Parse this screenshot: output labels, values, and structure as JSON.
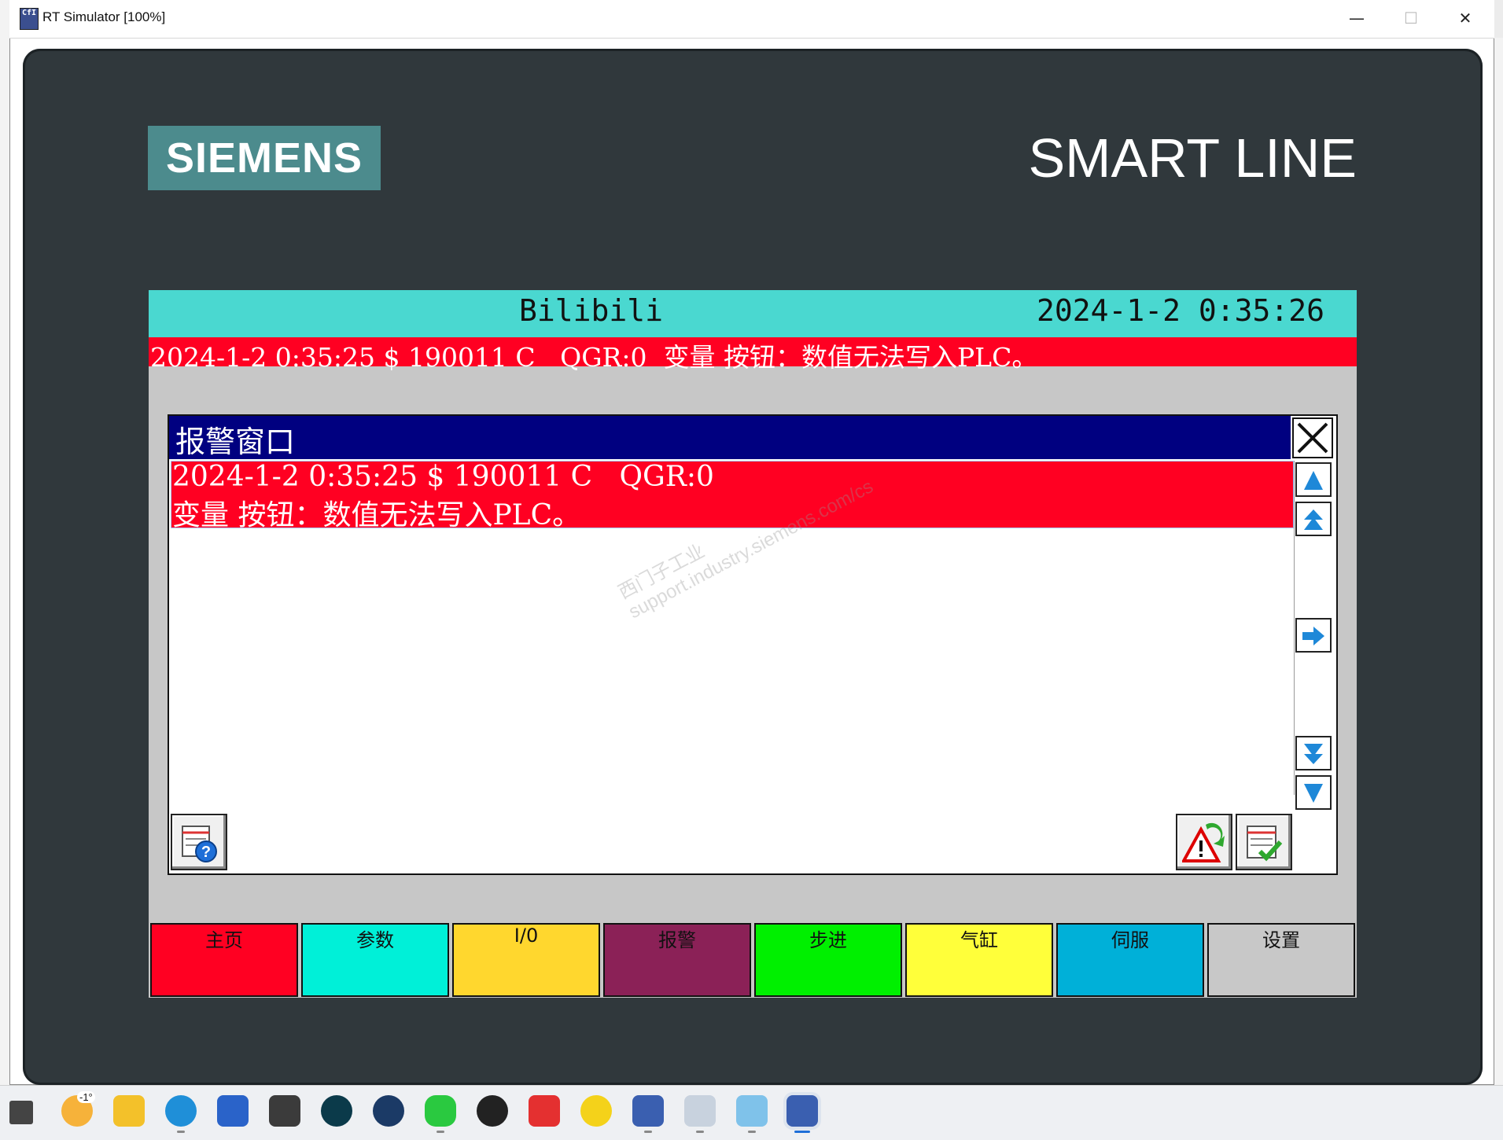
{
  "window": {
    "title": "RT Simulator [100%]",
    "icon_text": "CfI",
    "minimize_glyph": "—",
    "maximize_glyph": "☐",
    "close_glyph": "✕"
  },
  "device": {
    "brand": "SIEMENS",
    "model": "SMART LINE"
  },
  "screen": {
    "title": "Bilibili",
    "datetime": "2024-1-2 0:35:26",
    "alarm_line": "2024-1-2 0:35:25 $ 190011 C   QGR:0  变量 按钮：数值无法写入PLC。"
  },
  "alarm_window": {
    "title": "报警窗口",
    "entries": [
      {
        "line1": "2024-1-2 0:35:25 $ 190011 C   QGR:0",
        "line2": "变量 按钮：数值无法写入PLC。"
      }
    ],
    "watermark": "西门子工业 support.industry.siemens.com/cs"
  },
  "nav_buttons": [
    {
      "label": "主页",
      "color": "#ff0022"
    },
    {
      "label": "参数",
      "color": "#00f0d8"
    },
    {
      "label": "I/0",
      "color": "#ffd72e"
    },
    {
      "label": "报警",
      "color": "#8b2157"
    },
    {
      "label": "步进",
      "color": "#00f000"
    },
    {
      "label": "气缸",
      "color": "#ffff3a"
    },
    {
      "label": "伺服",
      "color": "#00b0d8"
    },
    {
      "label": "设置",
      "color": "#c8c8c8"
    }
  ],
  "taskbar": {
    "weather": "-1°"
  },
  "colors": {
    "header": "#4ad8d0",
    "alarm_red": "#ff0022",
    "alarm_window_title": "#000080",
    "bezel": "#30383c",
    "logo_bg": "#4c8b8d"
  }
}
